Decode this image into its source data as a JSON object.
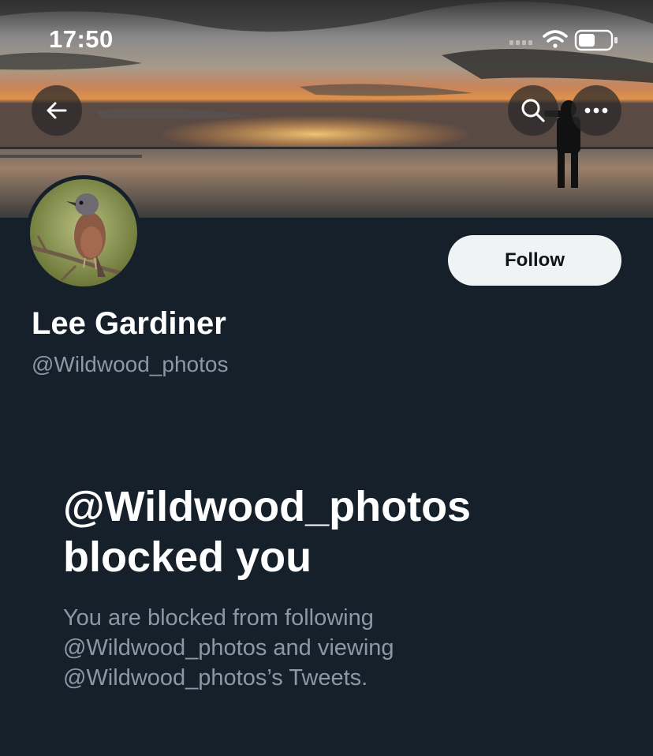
{
  "status_bar": {
    "time": "17:50",
    "icons": [
      "cellular-signal-icon",
      "wifi-icon",
      "battery-icon"
    ]
  },
  "header": {
    "back_icon": "arrow-left-icon",
    "search_icon": "search-icon",
    "more_icon": "more-horizontal-icon"
  },
  "profile": {
    "display_name": "Lee Gardiner",
    "handle": "@Wildwood_photos",
    "follow_label": "Follow"
  },
  "blocked": {
    "title_line1": "@Wildwood_photos",
    "title_line2": "blocked you",
    "desc_line1": "You are blocked from following",
    "desc_line2": "@Wildwood_photos and viewing",
    "desc_line3": "@Wildwood_photos’s Tweets."
  },
  "colors": {
    "background": "#15202b",
    "primary_text": "#ffffff",
    "secondary_text": "#8b98a5",
    "follow_button_bg": "#eff3f4",
    "follow_button_text": "#0f1419"
  }
}
